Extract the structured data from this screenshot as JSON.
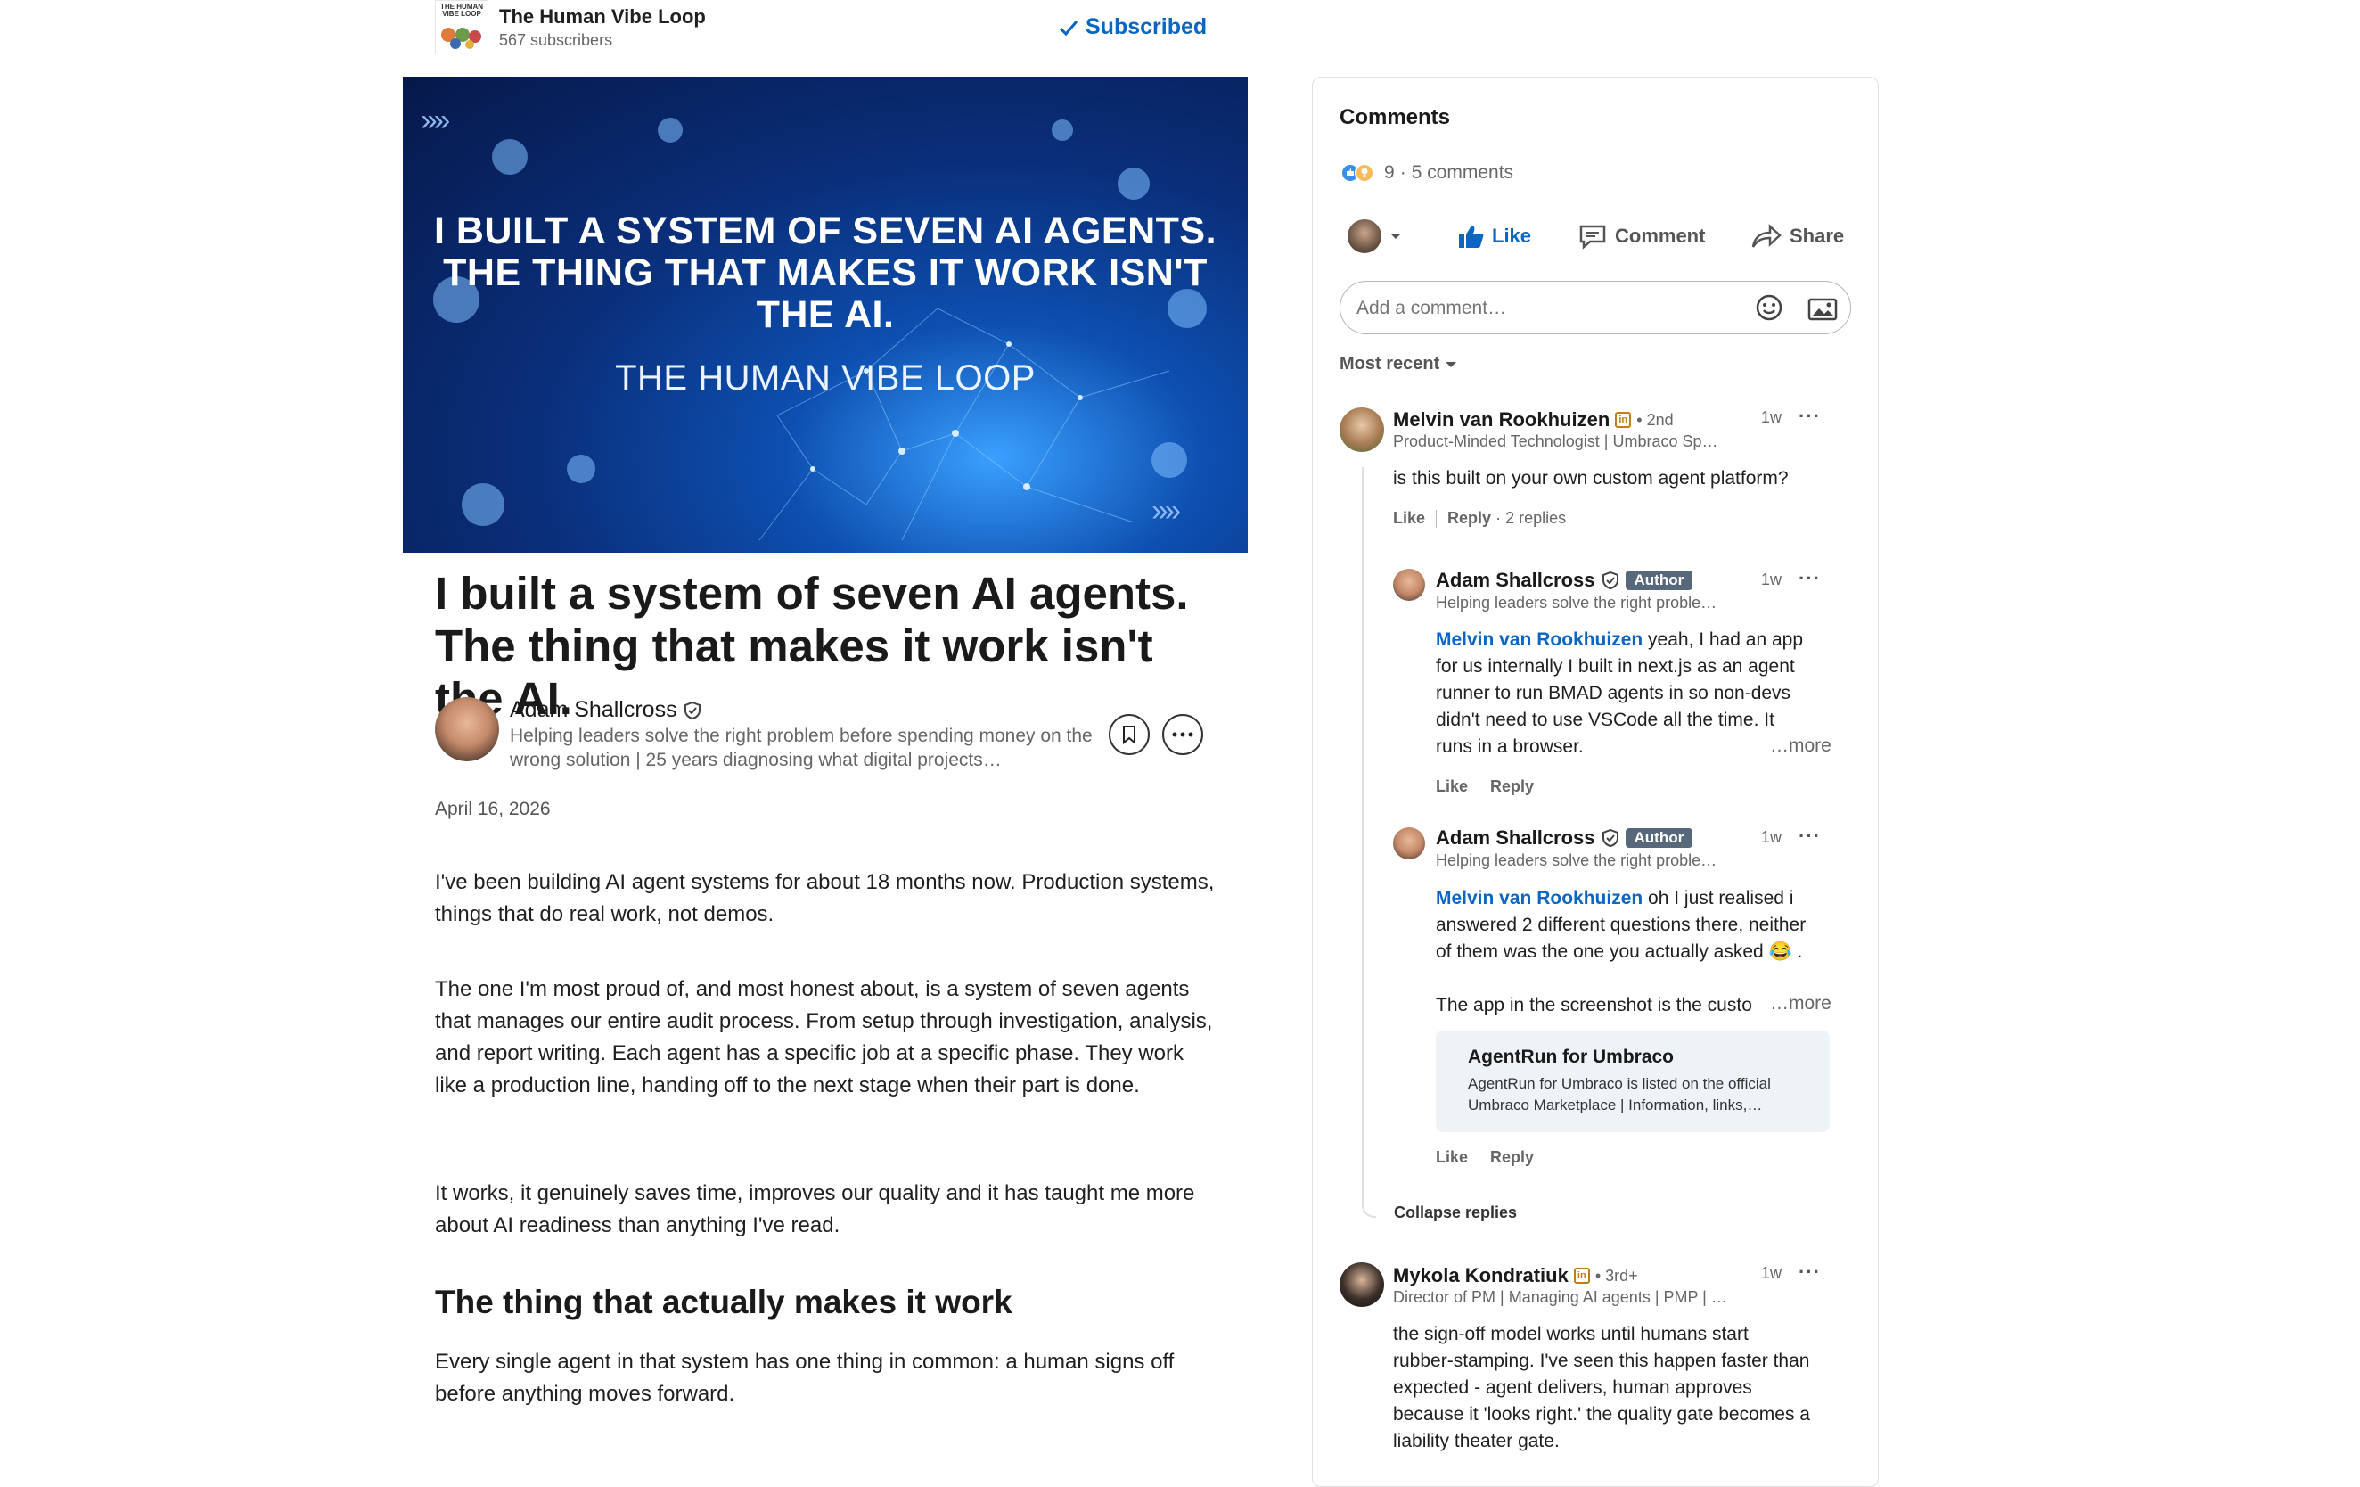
{
  "newsletter": {
    "name": "The Human Vibe Loop",
    "subscribers": "567 subscribers",
    "subscribed_label": "Subscribed",
    "logo_text": "THE HUMAN VIBE LOOP"
  },
  "hero": {
    "line1": "I BUILT A SYSTEM OF SEVEN AI AGENTS.",
    "line2": "THE THING THAT MAKES IT WORK ISN'T",
    "line3": "THE AI.",
    "sub": "THE HUMAN VIBE LOOP",
    "chevrons": "››››"
  },
  "article": {
    "title": "I built a system of seven AI agents. The thing that makes it work isn't the AI.",
    "author_name": "Adam Shallcross",
    "author_headline": "Helping leaders solve the right problem before spending money on the wrong solution | 25 years diagnosing what digital projects…",
    "date": "April 16, 2026",
    "paragraphs": [
      "I've been building AI agent systems for about 18 months now. Production systems, things that do real work, not demos.",
      "The one I'm most proud of, and most honest about, is a system of seven agents that manages our entire audit process. From setup through investigation, analysis, and report writing. Each agent has a specific job at a specific phase. They work like a production line, handing off to the next stage when their part is done.",
      "It works, it genuinely saves time, improves our quality and it has taught me more about AI readiness than anything I've read."
    ],
    "h2": "The thing that actually makes it work",
    "paragraph4": "Every single agent in that system has one thing in common: a human signs off before anything moves forward."
  },
  "comments": {
    "title": "Comments",
    "reaction_count": "9",
    "comment_count": "5 comments",
    "actions": {
      "like": "Like",
      "comment": "Comment",
      "share": "Share"
    },
    "add_placeholder": "Add a comment…",
    "sort_label": "Most recent",
    "items": [
      {
        "name": "Melvin van Rookhuizen",
        "degree": "2nd",
        "headline": "Product-Minded Technologist | Umbraco Sp…",
        "time": "1w",
        "text": "is this built on your own custom agent platform?",
        "like": "Like",
        "reply": "Reply",
        "replies": "2 replies"
      },
      {
        "name": "Adam Shallcross",
        "badge": "Author",
        "headline": "Helping leaders solve the right proble…",
        "time": "1w",
        "mention": "Melvin van Rookhuizen",
        "text_lines": [
          " yeah, I had an app",
          "for us internally I built in next.js as an agent",
          "runner to run BMAD agents in so non-devs",
          "didn't need to use VSCode all the time. It",
          "runs in a browser."
        ],
        "more": "…more",
        "like": "Like",
        "reply": "Reply"
      },
      {
        "name": "Adam Shallcross",
        "badge": "Author",
        "headline": "Helping leaders solve the right proble…",
        "time": "1w",
        "mention": "Melvin van Rookhuizen",
        "text_lines": [
          " oh I just realised i",
          "answered 2 different questions there, neither",
          "of them was the one you actually asked 😂 ."
        ],
        "text_last": "The app in the screenshot is the custo",
        "more": "…more",
        "card_title": "AgentRun for Umbraco",
        "card_desc_1": "AgentRun for Umbraco is listed on the official",
        "card_desc_2": "Umbraco Marketplace | Information, links,…",
        "like": "Like",
        "reply": "Reply"
      },
      {
        "name": "Mykola Kondratiuk",
        "degree": "3rd+",
        "headline": "Director of PM | Managing AI agents | PMP | …",
        "time": "1w",
        "text_lines": [
          "the sign-off model works until humans start",
          "rubber-stamping. I've seen this happen faster than",
          "expected - agent delivers, human approves",
          "because it 'looks right.' the quality gate becomes a",
          "liability theater gate."
        ]
      }
    ],
    "collapse_label": "Collapse replies"
  }
}
